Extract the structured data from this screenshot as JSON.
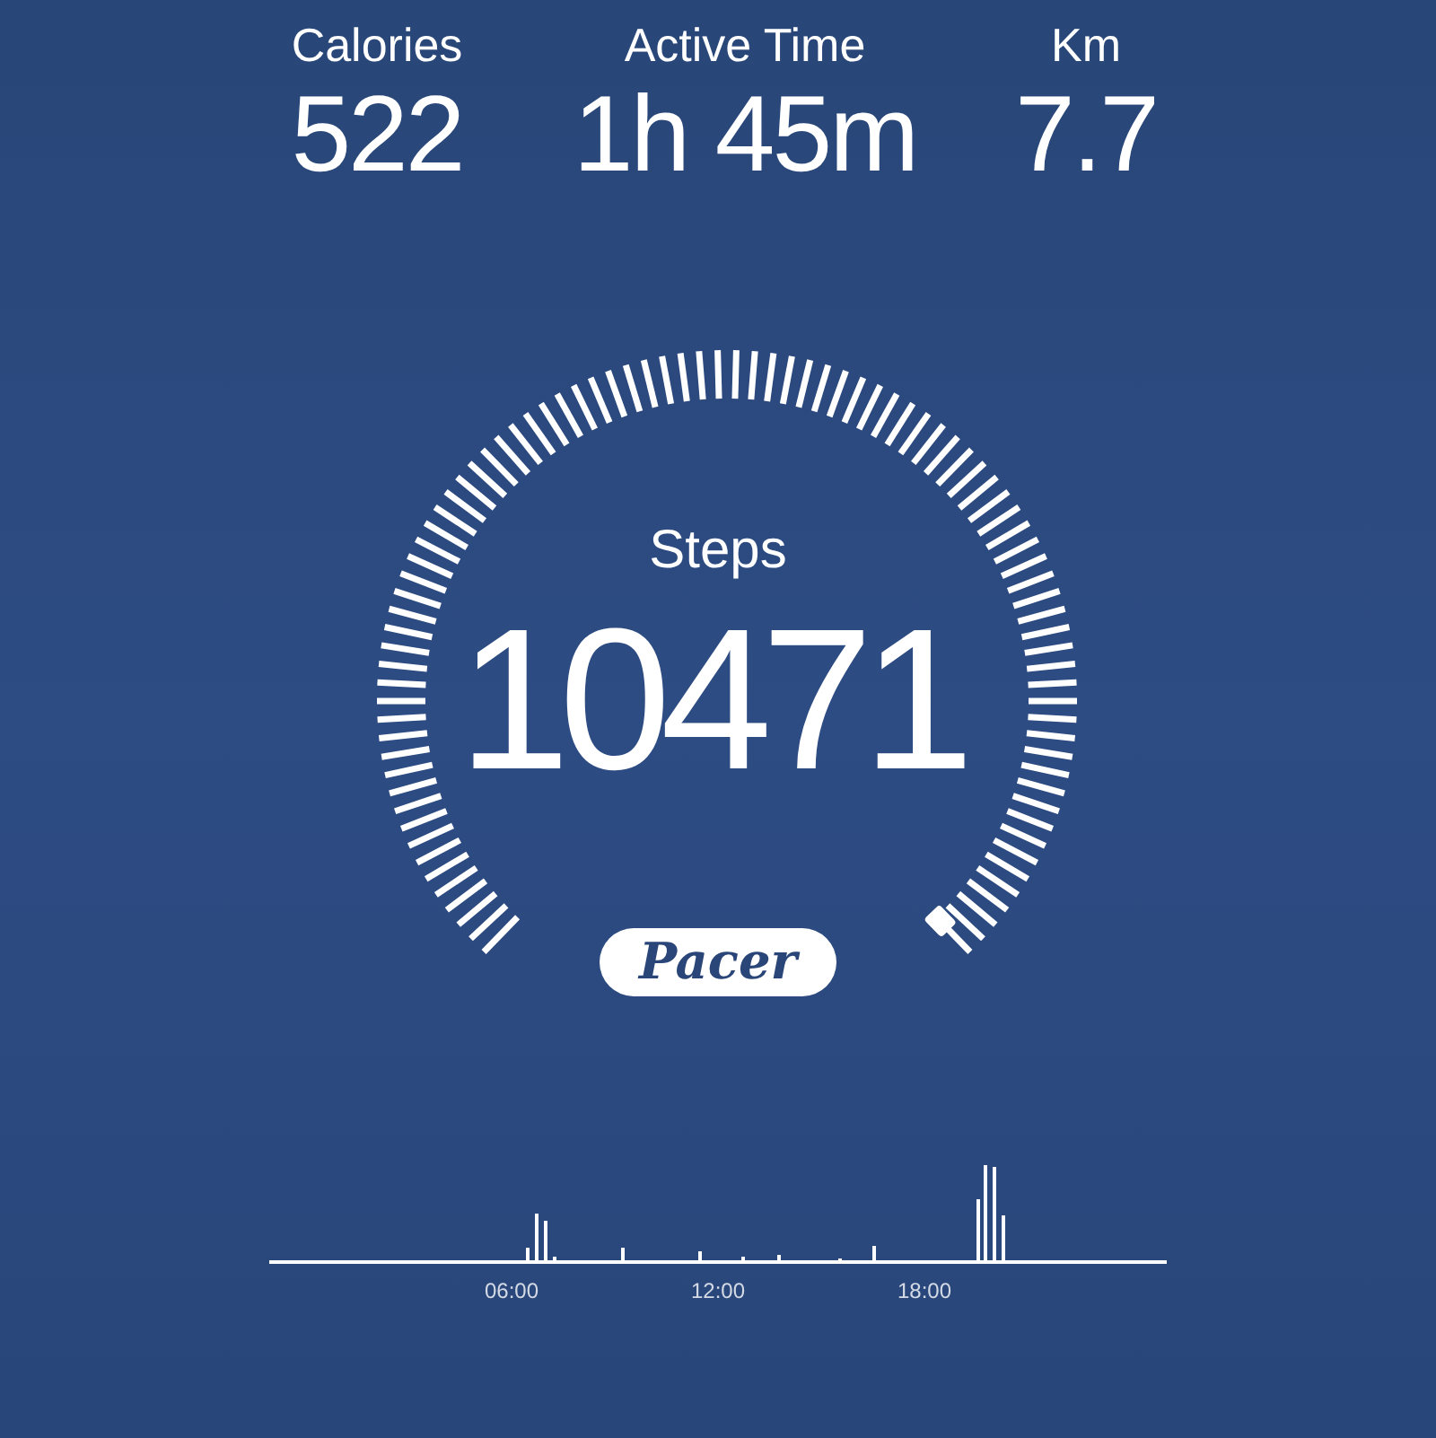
{
  "stats": [
    {
      "label": "Calories",
      "value": "522"
    },
    {
      "label": "Active Time",
      "value": "1h 45m"
    },
    {
      "label": "Km",
      "value": "7.7"
    }
  ],
  "gauge": {
    "label": "Steps",
    "value": "10471"
  },
  "badge": "Pacer",
  "activity_chart": {
    "x_labels": [
      "06:00",
      "12:00",
      "18:00"
    ]
  }
}
